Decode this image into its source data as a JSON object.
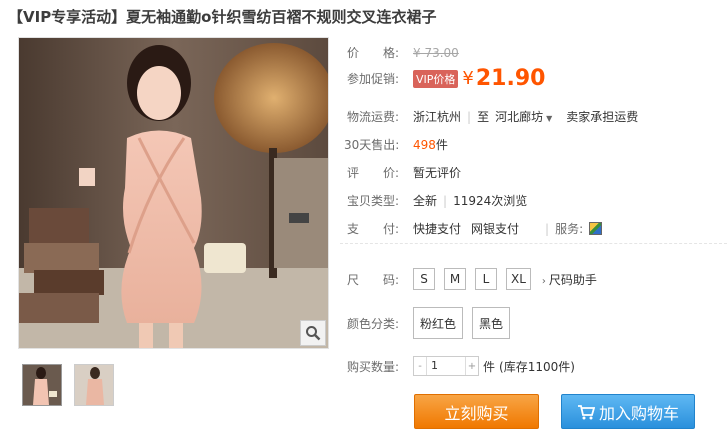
{
  "product": {
    "title": "【VIP专享活动】夏无袖通勤o针织雪纺百褶不规则交叉连衣裙子"
  },
  "price": {
    "label": "价　　格:",
    "original": "¥ 73.00",
    "promo_label": "参加促销:",
    "vip_tag": "VIP价格",
    "yen": "¥",
    "promo_price": "21.90"
  },
  "shipping": {
    "label": "物流运费:",
    "from": "浙江杭州",
    "to_prefix": "至",
    "to": "河北廊坊",
    "fee": "卖家承担运费"
  },
  "sales": {
    "label": "30天售出:",
    "count": "498",
    "unit": "件"
  },
  "review": {
    "label": "评　　价:",
    "value": "暂无评价"
  },
  "type": {
    "label": "宝贝类型:",
    "condition": "全新",
    "views": "11924次浏览"
  },
  "payment": {
    "label": "支　　付:",
    "methods": [
      "快捷支付",
      "网银支付"
    ],
    "service_label": "服务:"
  },
  "size": {
    "label": "尺　　码:",
    "options": [
      "S",
      "M",
      "L",
      "XL"
    ],
    "helper": "尺码助手"
  },
  "color": {
    "label": "颜色分类:",
    "options": [
      "粉红色",
      "黑色"
    ]
  },
  "quantity": {
    "label": "购买数量:",
    "minus": "-",
    "value": "1",
    "plus": "+",
    "unit": "件",
    "stock": "(库存1100件)"
  },
  "actions": {
    "buy_now": "立刻购买",
    "add_cart": "加入购物车"
  },
  "colors": {
    "accent_orange": "#ff5500",
    "buy_button": "#f07800",
    "cart_button": "#2a90dc"
  }
}
